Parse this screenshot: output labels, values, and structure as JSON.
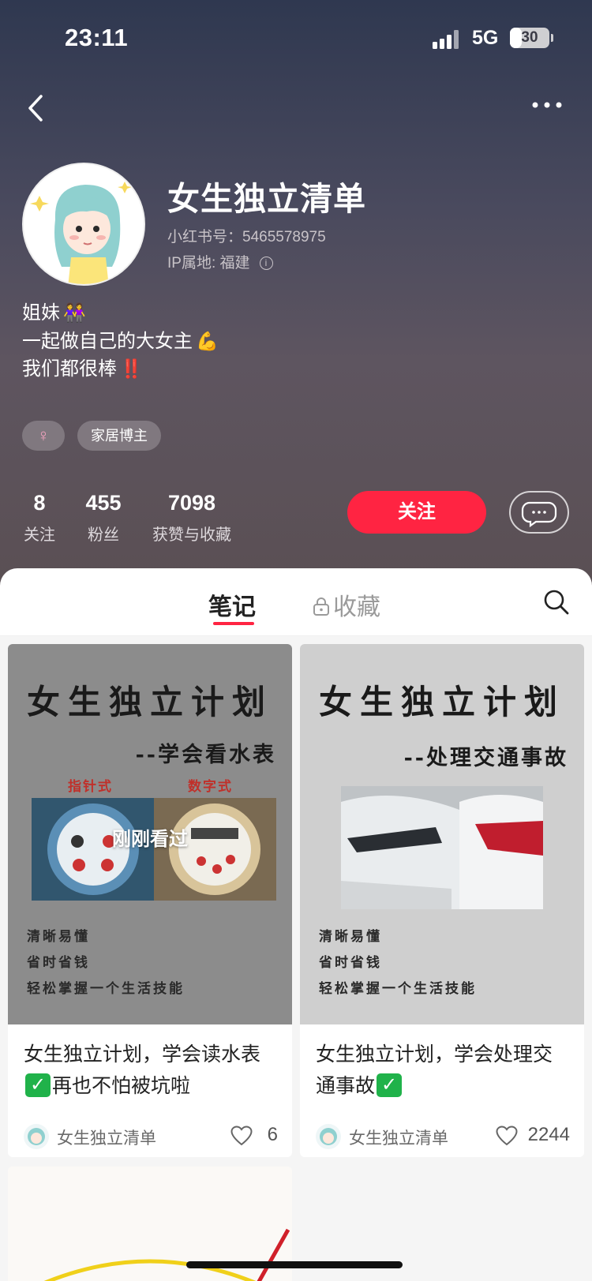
{
  "status_bar": {
    "time": "23:11",
    "network": "5G",
    "battery": "30",
    "battery_level": 0.3
  },
  "profile": {
    "name": "女生独立清单",
    "red_id": "小红书号：5465578975",
    "ip_location": "IP属地: 福建",
    "bio": [
      {
        "text": "姐妹",
        "emoji": "👭"
      },
      {
        "text": "一起做自己的大女主",
        "emoji": "💪"
      },
      {
        "text": "我们都很棒",
        "emoji": "‼️"
      }
    ],
    "tags": [
      {
        "label": "♀"
      },
      {
        "label": "家居博主"
      }
    ],
    "stats": [
      {
        "value": "8",
        "label": "关注"
      },
      {
        "value": "455",
        "label": "粉丝"
      },
      {
        "value": "7098",
        "label": "获赞与收藏"
      }
    ],
    "follow_label": "关注"
  },
  "tabs": {
    "notes": "笔记",
    "collect": "收藏"
  },
  "notes": [
    {
      "cover": {
        "title": "女生独立计划",
        "subtitle": "--学会看水表",
        "label_left": "指针式",
        "label_right": "数字式",
        "overlay": "刚刚看过",
        "bullets": [
          "清晰易懂",
          "省时省钱",
          "轻松掌握一个生活技能"
        ]
      },
      "title_a": "女生独立计划，学会读水表",
      "title_b": "再也不怕被坑啦",
      "author": "女生独立清单",
      "likes": "6"
    },
    {
      "cover": {
        "title": "女生独立计划",
        "subtitle": "--处理交通事故",
        "bullets": [
          "清晰易懂",
          "省时省钱",
          "轻松掌握一个生活技能"
        ]
      },
      "title_a": "女生独立计划，学会处理交通事故",
      "title_b": "",
      "author": "女生独立清单",
      "likes": "2244"
    }
  ],
  "colors": {
    "accent": "#ff2442",
    "check": "#20b24a"
  }
}
